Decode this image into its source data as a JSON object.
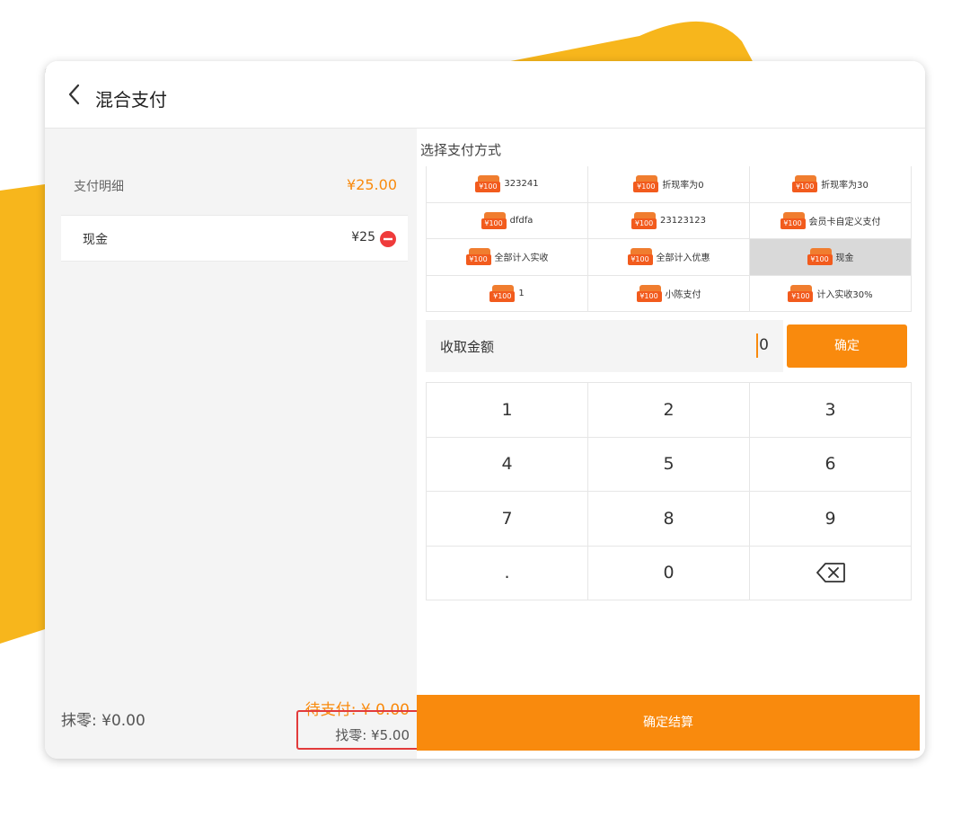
{
  "header": {
    "title": "混合支付"
  },
  "summary": {
    "label": "支付明细",
    "amount": "¥25.00"
  },
  "payments": [
    {
      "name": "现金",
      "amount": "¥25"
    }
  ],
  "footer": {
    "zero_label": "抹零: ¥0.00",
    "pending": "待支付: ¥ 0.00",
    "change": "找零: ¥5.00"
  },
  "methods": {
    "label": "选择支付方式",
    "card_text": "¥100",
    "items": [
      {
        "label": "323241"
      },
      {
        "label": "折现率为0"
      },
      {
        "label": "折现率为30"
      },
      {
        "label": "dfdfa"
      },
      {
        "label": "23123123"
      },
      {
        "label": "会员卡自定义支付"
      },
      {
        "label": "全部计入实收"
      },
      {
        "label": "全部计入优惠"
      },
      {
        "label": "现金",
        "selected": true
      },
      {
        "label": "1"
      },
      {
        "label": "小陈支付"
      },
      {
        "label": "计入实收30%"
      }
    ]
  },
  "amount_input": {
    "label": "收取金额",
    "value": "0"
  },
  "confirm": {
    "label": "确定"
  },
  "keypad": {
    "keys": [
      "1",
      "2",
      "3",
      "4",
      "5",
      "6",
      "7",
      "8",
      "9",
      ".",
      "0"
    ],
    "backspace_icon": "backspace-icon"
  },
  "settle": {
    "label": "确定结算"
  },
  "colors": {
    "accent": "#f98a0d",
    "deco": "#f7b61c",
    "highlight_border": "#e23b3b",
    "selected_bg": "#d9d9d9"
  }
}
